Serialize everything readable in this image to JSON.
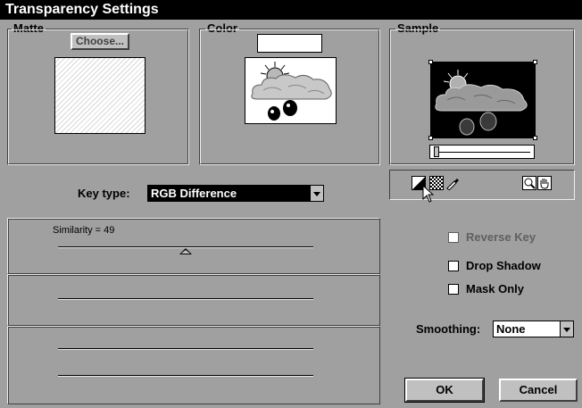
{
  "window": {
    "title": "Transparency Settings"
  },
  "matte": {
    "legend": "Matte",
    "choose_label": "Choose..."
  },
  "color": {
    "legend": "Color"
  },
  "sample": {
    "legend": "Sample",
    "slider_value": 0
  },
  "tools": {
    "items": [
      "key-color-icon",
      "checkerboard-icon",
      "eyedropper-icon",
      "zoom-icon",
      "hand-icon"
    ]
  },
  "key_type": {
    "label": "Key type:",
    "value": "RGB Difference"
  },
  "similarity": {
    "label": "Similarity = 49",
    "value": 49
  },
  "options": {
    "reverse_key": "Reverse Key",
    "drop_shadow": "Drop Shadow",
    "mask_only": "Mask Only"
  },
  "smoothing": {
    "label": "Smoothing:",
    "value": "None"
  },
  "buttons": {
    "ok": "OK",
    "cancel": "Cancel"
  }
}
